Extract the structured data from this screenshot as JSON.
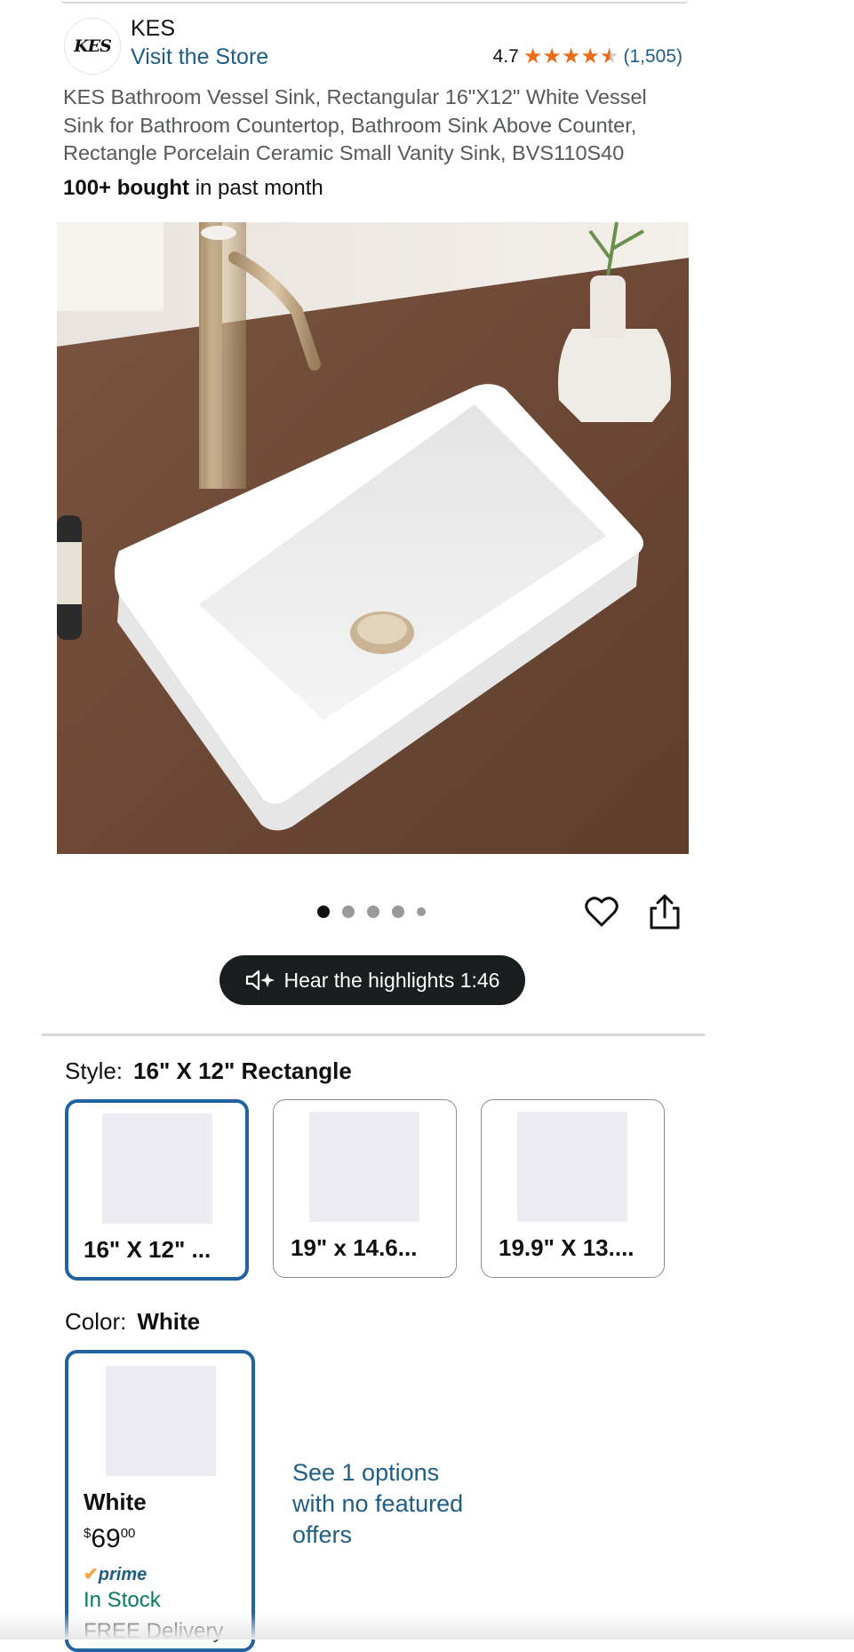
{
  "brand": {
    "logo_text": "KES",
    "name": "KES",
    "store_link": "Visit the Store"
  },
  "rating": {
    "value": "4.7",
    "stars": 4.7,
    "count": "(1,505)"
  },
  "product": {
    "title": "KES Bathroom Vessel Sink, Rectangular 16\"X12\" White Vessel Sink for Bathroom Countertop, Bathroom Sink Above Counter, Rectangle Porcelain Ceramic Small Vanity Sink, BVS110S40",
    "bought_bold": "100+ bought",
    "bought_rest": " in past month"
  },
  "gallery": {
    "image_count": 5,
    "active_index": 0
  },
  "highlights": {
    "label": "Hear the highlights 1:46"
  },
  "style": {
    "label": "Style:",
    "selected": "16\" X 12\" Rectangle",
    "options": [
      "16\" X 12\" ...",
      "19\" x 14.6...",
      "19.9\" X 13...."
    ]
  },
  "color": {
    "label": "Color:",
    "selected": "White",
    "option": {
      "name": "White",
      "price_currency": "$",
      "price_whole": "69",
      "price_fraction": "00",
      "prime": "prime",
      "stock": "In Stock",
      "delivery": "FREE Delivery"
    },
    "see_options": "See 1 options with no featured offers"
  },
  "colors": {
    "link": "#1f5d84",
    "star": "#e86c1a",
    "selected_border": "#2162a1",
    "in_stock": "#067d62"
  }
}
